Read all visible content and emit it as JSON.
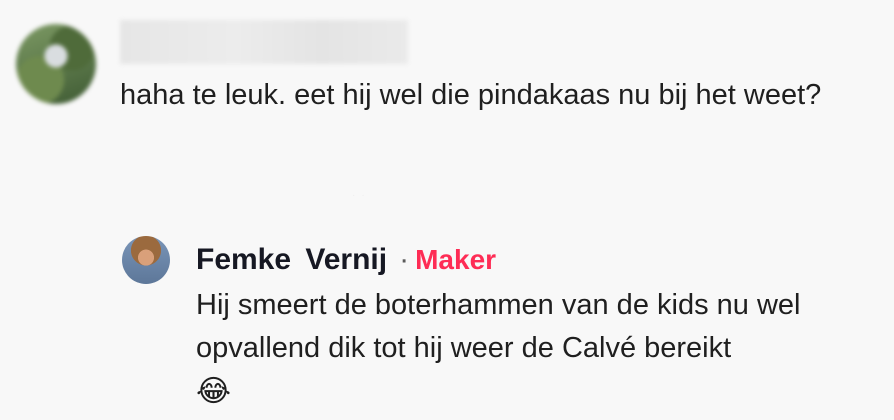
{
  "comment": {
    "username": "",
    "text": "haha te leuk. eet hij wel die pindakaas nu bij het weet?"
  },
  "reply": {
    "author": "Femke  Vernij",
    "separator": "·",
    "badge": "Maker",
    "text": "Hij smeert de boterhammen van de kids nu wel opvallend dik tot hij weer de Calvé bereikt",
    "emoji": "😂"
  },
  "colors": {
    "badge": "#fe2c55",
    "text": "#1f1f1f",
    "background": "#f8f8f8"
  },
  "icons": {
    "reply_emoji": "face-with-tears-of-joy-icon"
  }
}
